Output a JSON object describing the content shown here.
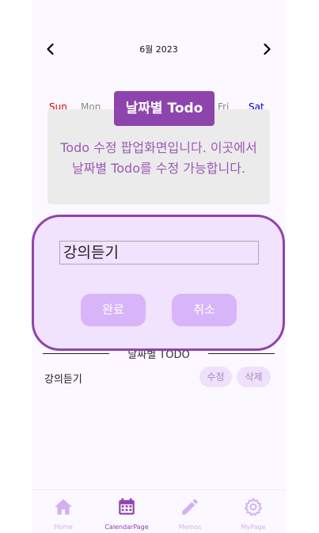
{
  "calendar": {
    "month_label": "6월 2023",
    "weekdays": [
      {
        "label": "Sun",
        "color": "#e00000"
      },
      {
        "label": "Mon",
        "color": "#888888"
      },
      {
        "label": "Fri",
        "color": "#888888"
      },
      {
        "label": "Sat",
        "color": "#0000cc"
      }
    ]
  },
  "tooltip": {
    "tag": "날짜별 Todo",
    "text": "Todo 수정 팝업화면입니다. 이곳에서 날짜별 Todo를 수정 가능합니다."
  },
  "modal": {
    "input_value": "강의듣기",
    "confirm_label": "완료",
    "cancel_label": "취소"
  },
  "todo_section": {
    "title": "날짜별 TODO",
    "items": [
      {
        "text": "강의듣기",
        "edit_label": "수정",
        "delete_label": "삭제"
      }
    ]
  },
  "bottom_nav": {
    "tabs": [
      {
        "label": "Home",
        "icon": "home-icon"
      },
      {
        "label": "CalendarPage",
        "icon": "calendar-icon"
      },
      {
        "label": "Memos",
        "icon": "pencil-icon"
      },
      {
        "label": "MyPage",
        "icon": "gear-icon"
      }
    ]
  },
  "colors": {
    "accent": "#8e44ad",
    "accent_light": "#d8b5f8",
    "nav_icon": "#d3b1f0",
    "modal_bg": "#f1e2fd"
  }
}
